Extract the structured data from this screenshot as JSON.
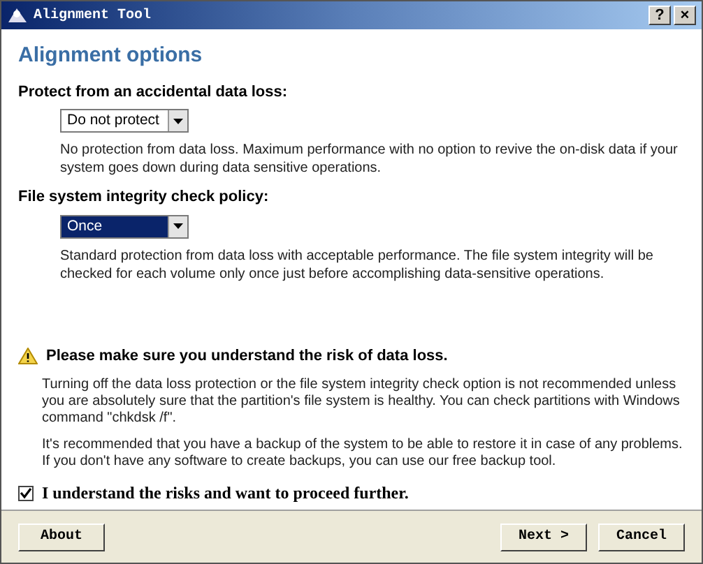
{
  "window": {
    "title": "Alignment Tool",
    "controls": [
      "?",
      "×"
    ]
  },
  "heading": "Alignment options",
  "sections": [
    {
      "label": "Protect from an accidental data loss:",
      "dropdown": {
        "value": "Do not protect",
        "focused": false
      },
      "description": "No protection from data loss. Maximum performance with no option to revive the on-disk data if your system goes down during data sensitive operations."
    },
    {
      "label": "File system integrity check policy:",
      "dropdown": {
        "value": "Once",
        "focused": true
      },
      "description": "Standard protection from data loss with acceptable performance. The file system integrity will be checked for each volume only once just before accomplishing data-sensitive operations."
    }
  ],
  "warning": {
    "title": "Please make sure you understand the risk of data loss.",
    "paragraphs": [
      "Turning off the data loss protection or the file system integrity check option is not recommended unless you are absolutely sure that the partition's file system is healthy. You can check partitions with Windows command \"chkdsk /f\".",
      "It's recommended that you have a backup of the system to be able to restore it in case of any problems. If you don't have any software to create backups, you can use our free backup tool."
    ]
  },
  "confirm": {
    "label": "I understand the risks and want to proceed further.",
    "checked": true
  },
  "buttons": [
    {
      "label": "About",
      "kind": "left"
    },
    {
      "label": "Next >",
      "kind": "right"
    },
    {
      "label": "Cancel",
      "kind": "right"
    }
  ]
}
